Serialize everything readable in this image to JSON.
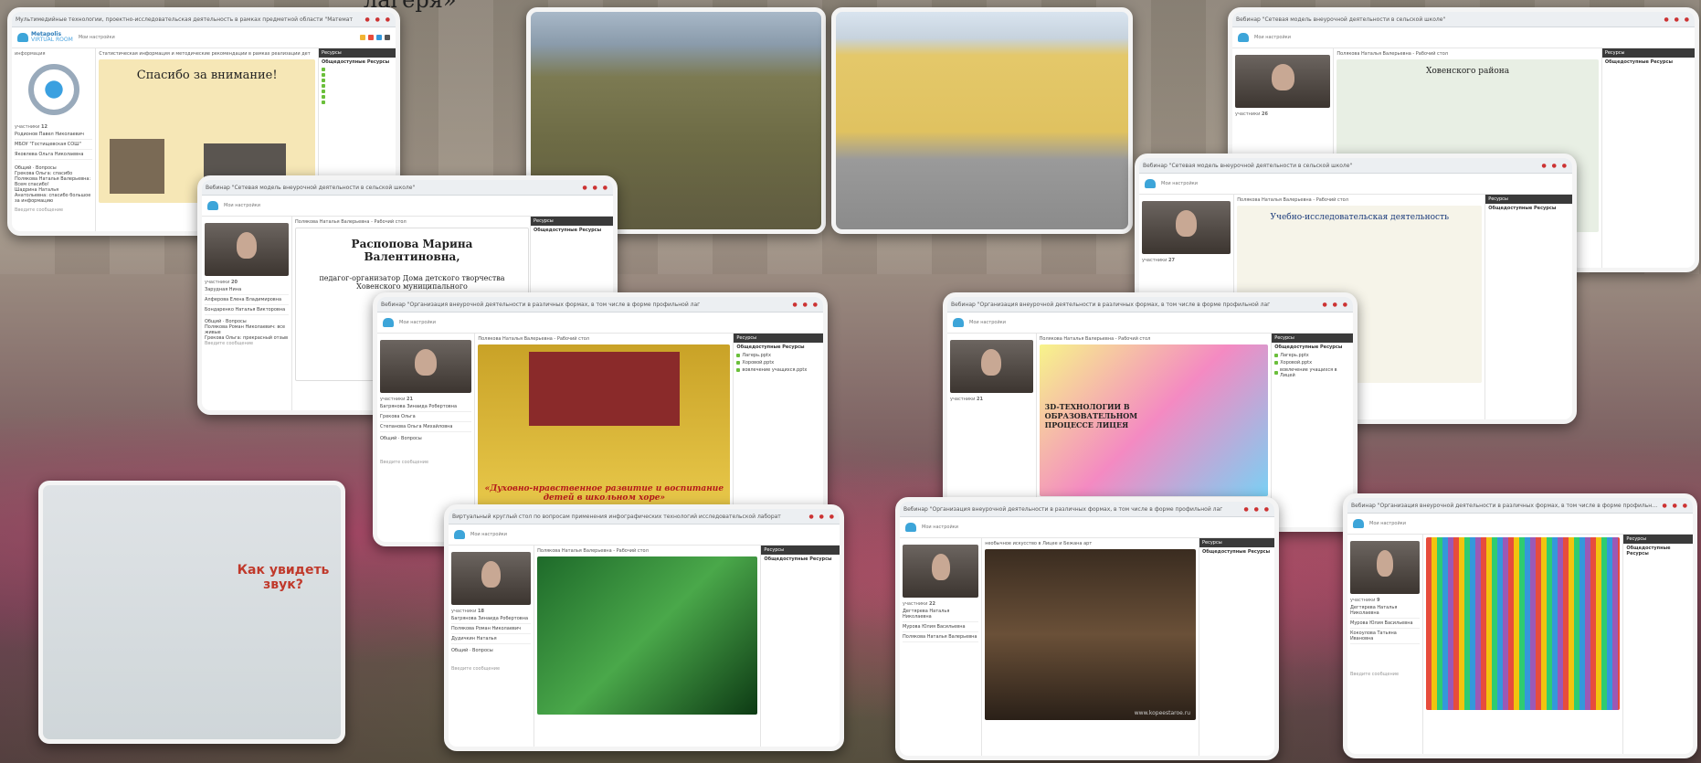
{
  "page": {
    "top_title": "лагеря»"
  },
  "shots": {
    "s1": {
      "tab": "Мультимедийные технологии, проектно-исследовательская деятельность в рамках предметной области \"Математ",
      "logo_main": "Metapolis",
      "logo_sub": "VIRTUAL ROOM",
      "settings": "Мои настройки",
      "left_label": "информация",
      "participants_label": "участники",
      "participants_count": "12",
      "participants": [
        "Родионов Павел Николаевич",
        "МБОУ \"Гостищевская СОШ\"",
        "Яковлева Ольга Николаевна"
      ],
      "center_title": "Статистическая информация и методические рекомендации в рамках реализации дет",
      "slide_text": "Спасибо за внимание!",
      "res_title": "Ресурсы",
      "res_sub": "Общедоступные Ресурсы",
      "chat_tab1": "Общий",
      "chat_tab2": "Вопросы",
      "chat_lines": [
        "Грекова Ольга: спасибо",
        "Полякова Наталья Валерьевна: Всем спасибо!",
        "Шадрина Наталья Анатольевна: спасибо большое за информацию"
      ],
      "input_placeholder": "Введите сообщение"
    },
    "s2": {
      "tab": "Вебинар \"Сетевая модель внеурочной деятельности в сельской школе\"",
      "settings": "Мои настройки",
      "center_title": "Полякова Наталья Валерьевна - Рабочий стол",
      "slide_name": "Распопова Марина Валентиновна,",
      "slide_role": "педагог-организатор Дома детского творчества Ховенского муниципального",
      "res_title": "Ресурсы",
      "res_sub": "Общедоступные Ресурсы",
      "participants_label": "участники",
      "participants_count": "20",
      "participants": [
        "Зарудная Нина",
        "Алферова Елена Владимировна",
        "Бондаренко Наталья Викторовна"
      ],
      "chat_tab1": "Общий",
      "chat_tab2": "Вопросы",
      "chat_lines": [
        "Полякова Роман Николаевич: все живые",
        "Грекова Ольга: прекрасный отзыв"
      ],
      "input_placeholder": "Введите сообщение"
    },
    "s3": {
      "tab": "Вебинар \"Организация внеурочной деятельности в различных формах, в том числе в форме профильной лаг",
      "settings": "Мои настройки",
      "center_title": "Полякова Наталья Валерьевна - Рабочий стол",
      "slide_text": "«Духовно-нравственное развитие и воспитание детей в школьном хоре»",
      "res_title": "Ресурсы",
      "res_sub": "Общедоступные Ресурсы",
      "res_items": [
        "Лагерь.pptx",
        "Хоровой.pptx",
        "вовлечение учащихся.pptx"
      ],
      "participants_label": "участники",
      "participants_count": "21",
      "participants": [
        "Багрянова Зинаида Робертовна",
        "Грекова Ольга",
        "Степанова Ольга Михайловна"
      ],
      "chat_tab1": "Общий",
      "chat_tab2": "Вопросы",
      "input_placeholder": "Введите сообщение"
    },
    "s4": {
      "tab": "Вебинар \"Организация внеурочной деятельности в различных формах, в том числе в форме профильной лаг",
      "settings": "Мои настройки",
      "center_title": "Полякова Наталья Валерьевна - Рабочий стол",
      "slide_text": "3D-ТЕХНОЛОГИИ В ОБРАЗОВАТЕЛЬНОМ ПРОЦЕССЕ ЛИЦЕЯ",
      "res_title": "Ресурсы",
      "res_sub": "Общедоступные Ресурсы",
      "res_items": [
        "Лагерь.pptx",
        "Хоровой.pptx",
        "вовлечение учащихся в Лицей"
      ],
      "participants_label": "участники",
      "participants_count": "21"
    },
    "s5": {
      "tab": "Вебинар \"Сетевая модель внеурочной деятельности в сельской школе\"",
      "settings": "Мои настройки",
      "center_title": "Полякова Наталья Валерьевна - Рабочий стол",
      "slide_text": "Учебно-исследовательская деятельность",
      "res_title": "Ресурсы",
      "res_sub": "Общедоступные Ресурсы",
      "participants_label": "участники",
      "participants_count": "27"
    },
    "s6": {
      "tab": "Вебинар \"Сетевая модель внеурочной деятельности в сельской школе\"",
      "settings": "Мои настройки",
      "center_title": "Полякова Наталья Валерьевна - Рабочий стол",
      "slide_text": "Ховенского района",
      "res_title": "Ресурсы",
      "res_sub": "Общедоступные Ресурсы",
      "participants_label": "участники",
      "participants_count": "26"
    },
    "s7": {
      "tab": "Виртуальный круглый стол по вопросам применения инфографических технологий исследовательской лаборат",
      "settings": "Мои настройки",
      "center_title": "Полякова Наталья Валерьевна - Рабочий стол",
      "res_title": "Ресурсы",
      "res_sub": "Общедоступные Ресурсы",
      "participants_label": "участники",
      "participants_count": "18",
      "participants": [
        "Багрянова Зинаида Робертовна",
        "Полякова Роман Николаевич",
        "Дудичкин Наталья"
      ],
      "chat_tab1": "Общий",
      "chat_tab2": "Вопросы",
      "input_placeholder": "Введите сообщение"
    },
    "s8": {
      "tab": "Вебинар \"Организация внеурочной деятельности в различных формах, в том числе в форме профильной лаг",
      "settings": "Мои настройки",
      "center_title": "необычное искусство в Лицее и Бежана арт",
      "res_title": "Ресурсы",
      "res_sub": "Общедоступные Ресурсы",
      "participants_label": "участники",
      "participants_count": "22",
      "participants": [
        "Дегтярева Наталья Николаевна",
        "Мурова Юлия Васильевна",
        "Полякова Наталья Валерьевна"
      ],
      "watermark": "www.kopeestaroe.ru"
    },
    "s9": {
      "tab": "Вебинар \"Организация внеурочной деятельности в различных формах, в том числе в форме профильной лаг",
      "settings": "Мои настройки",
      "res_title": "Ресурсы",
      "res_sub": "Общедоступные Ресурсы",
      "participants_label": "участники",
      "participants_count": "9",
      "participants": [
        "Дегтярева Наталья Николаевна",
        "Мурова Юлия Васильевна",
        "Кокоулова Татьяна Ивановна"
      ],
      "input_placeholder": "Введите сообщение"
    },
    "s10": {
      "slide_text": "Как увидеть звук?"
    }
  }
}
